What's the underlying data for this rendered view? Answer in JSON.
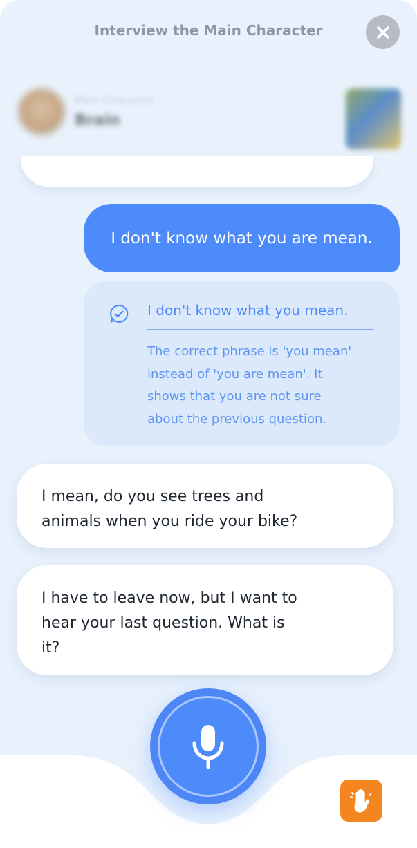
{
  "header": {
    "title": "Interview the Main Character",
    "close_icon": "close-icon"
  },
  "character": {
    "role": "Main Character",
    "name": "Brain",
    "avatar_icon": "character-avatar",
    "book_icon": "book-cover-thumbnail"
  },
  "messages": {
    "user_message": "I don't know what you are mean.",
    "correction": {
      "icon": "check-circle-icon",
      "corrected": "I don't know what you mean.",
      "explanation": [
        "The correct phrase is 'you mean'",
        "instead of 'you are mean'. It",
        "shows that you are not sure",
        "about the previous question."
      ]
    },
    "bot_1": [
      "I mean, do you see trees and",
      "animals when you ride your bike?"
    ],
    "bot_2": [
      "I have to leave now, but I want to",
      "hear your last question. What is",
      "it?"
    ]
  },
  "controls": {
    "mic_icon": "microphone-icon",
    "hand_icon": "raise-hand-icon"
  },
  "colors": {
    "accent": "#4d8bfb",
    "background": "#e8f1fc",
    "correction_bg": "#dce9fb",
    "hand_button": "#f5861f",
    "close_button": "#b7bcc4"
  }
}
